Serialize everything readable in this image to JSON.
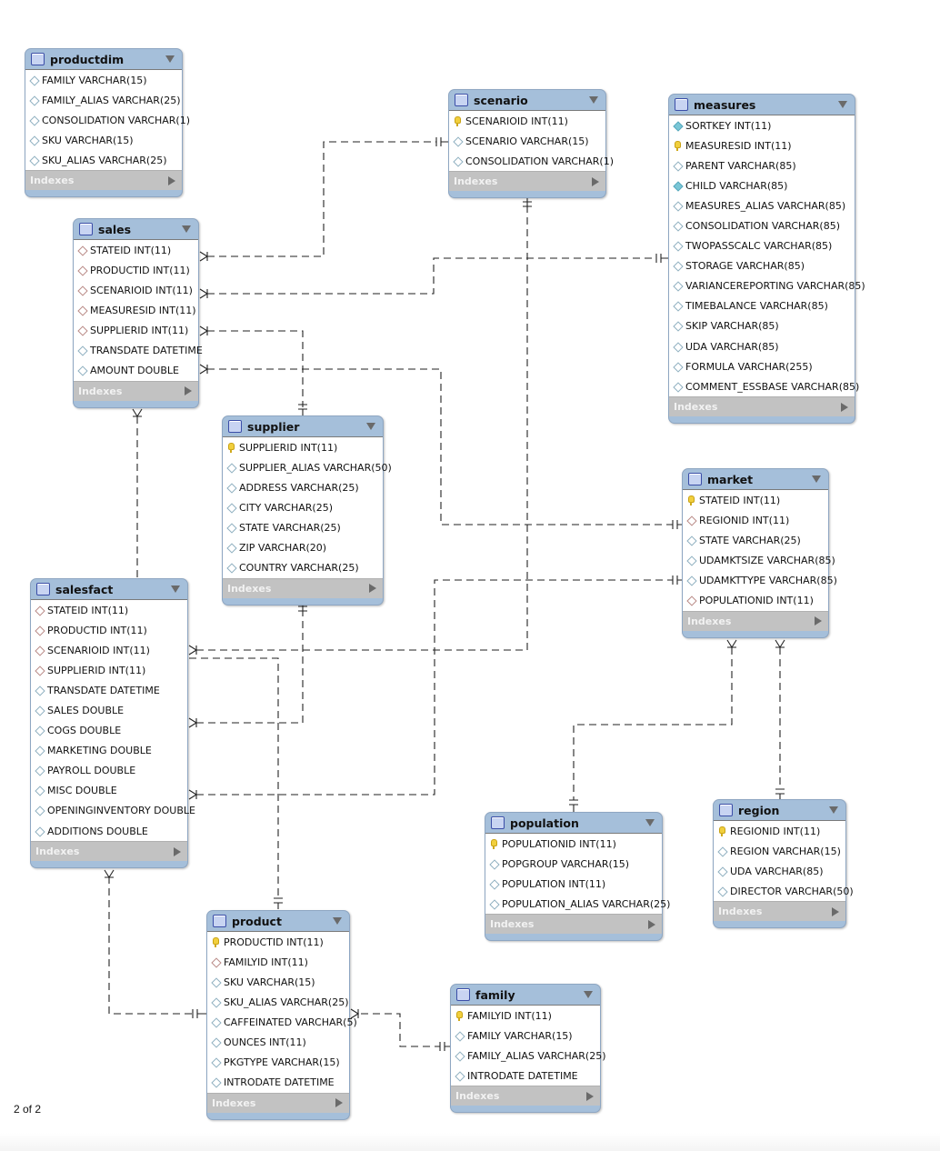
{
  "diagram": {
    "footer_label": "Indexes",
    "page_counter": "2 of 2",
    "tables": {
      "productdim": {
        "name": "productdim",
        "columns": [
          {
            "text": "FAMILY VARCHAR(15)",
            "icon": "column-diamond"
          },
          {
            "text": "FAMILY_ALIAS VARCHAR(25)",
            "icon": "column-diamond"
          },
          {
            "text": "CONSOLIDATION VARCHAR(1)",
            "icon": "column-diamond"
          },
          {
            "text": "SKU VARCHAR(15)",
            "icon": "column-diamond"
          },
          {
            "text": "SKU_ALIAS VARCHAR(25)",
            "icon": "column-diamond"
          }
        ]
      },
      "scenario": {
        "name": "scenario",
        "columns": [
          {
            "text": "SCENARIOID INT(11)",
            "icon": "primary-key"
          },
          {
            "text": "SCENARIO VARCHAR(15)",
            "icon": "column-diamond"
          },
          {
            "text": "CONSOLIDATION VARCHAR(1)",
            "icon": "column-diamond"
          }
        ]
      },
      "measures": {
        "name": "measures",
        "columns": [
          {
            "text": "SORTKEY INT(11)",
            "icon": "column-diamond-filled"
          },
          {
            "text": "MEASURESID INT(11)",
            "icon": "primary-key"
          },
          {
            "text": "PARENT VARCHAR(85)",
            "icon": "column-diamond"
          },
          {
            "text": "CHILD VARCHAR(85)",
            "icon": "column-diamond-filled"
          },
          {
            "text": "MEASURES_ALIAS VARCHAR(85)",
            "icon": "column-diamond"
          },
          {
            "text": "CONSOLIDATION VARCHAR(85)",
            "icon": "column-diamond"
          },
          {
            "text": "TWOPASSCALC VARCHAR(85)",
            "icon": "column-diamond"
          },
          {
            "text": "STORAGE VARCHAR(85)",
            "icon": "column-diamond"
          },
          {
            "text": "VARIANCEREPORTING VARCHAR(85)",
            "icon": "column-diamond"
          },
          {
            "text": "TIMEBALANCE VARCHAR(85)",
            "icon": "column-diamond"
          },
          {
            "text": "SKIP VARCHAR(85)",
            "icon": "column-diamond"
          },
          {
            "text": "UDA VARCHAR(85)",
            "icon": "column-diamond"
          },
          {
            "text": "FORMULA VARCHAR(255)",
            "icon": "column-diamond"
          },
          {
            "text": "COMMENT_ESSBASE VARCHAR(85)",
            "icon": "column-diamond"
          }
        ]
      },
      "sales": {
        "name": "sales",
        "columns": [
          {
            "text": "STATEID INT(11)",
            "icon": "foreign-key-diamond"
          },
          {
            "text": "PRODUCTID INT(11)",
            "icon": "foreign-key-diamond"
          },
          {
            "text": "SCENARIOID INT(11)",
            "icon": "foreign-key-diamond"
          },
          {
            "text": "MEASURESID INT(11)",
            "icon": "foreign-key-diamond"
          },
          {
            "text": "SUPPLIERID INT(11)",
            "icon": "foreign-key-diamond"
          },
          {
            "text": "TRANSDATE DATETIME",
            "icon": "column-diamond"
          },
          {
            "text": "AMOUNT DOUBLE",
            "icon": "column-diamond"
          }
        ]
      },
      "supplier": {
        "name": "supplier",
        "columns": [
          {
            "text": "SUPPLIERID INT(11)",
            "icon": "primary-key"
          },
          {
            "text": "SUPPLIER_ALIAS VARCHAR(50)",
            "icon": "column-diamond"
          },
          {
            "text": "ADDRESS VARCHAR(25)",
            "icon": "column-diamond"
          },
          {
            "text": "CITY VARCHAR(25)",
            "icon": "column-diamond"
          },
          {
            "text": "STATE VARCHAR(25)",
            "icon": "column-diamond"
          },
          {
            "text": "ZIP VARCHAR(20)",
            "icon": "column-diamond"
          },
          {
            "text": "COUNTRY VARCHAR(25)",
            "icon": "column-diamond"
          }
        ]
      },
      "market": {
        "name": "market",
        "columns": [
          {
            "text": "STATEID INT(11)",
            "icon": "primary-key"
          },
          {
            "text": "REGIONID INT(11)",
            "icon": "foreign-key-diamond"
          },
          {
            "text": "STATE VARCHAR(25)",
            "icon": "column-diamond"
          },
          {
            "text": "UDAMKTSIZE VARCHAR(85)",
            "icon": "column-diamond"
          },
          {
            "text": "UDAMKTTYPE VARCHAR(85)",
            "icon": "column-diamond"
          },
          {
            "text": "POPULATIONID INT(11)",
            "icon": "foreign-key-diamond"
          }
        ]
      },
      "salesfact": {
        "name": "salesfact",
        "columns": [
          {
            "text": "STATEID INT(11)",
            "icon": "foreign-key-diamond"
          },
          {
            "text": "PRODUCTID INT(11)",
            "icon": "foreign-key-diamond"
          },
          {
            "text": "SCENARIOID INT(11)",
            "icon": "foreign-key-diamond"
          },
          {
            "text": "SUPPLIERID INT(11)",
            "icon": "foreign-key-diamond"
          },
          {
            "text": "TRANSDATE DATETIME",
            "icon": "column-diamond"
          },
          {
            "text": "SALES DOUBLE",
            "icon": "column-diamond"
          },
          {
            "text": "COGS DOUBLE",
            "icon": "column-diamond"
          },
          {
            "text": "MARKETING DOUBLE",
            "icon": "column-diamond"
          },
          {
            "text": "PAYROLL DOUBLE",
            "icon": "column-diamond"
          },
          {
            "text": "MISC DOUBLE",
            "icon": "column-diamond"
          },
          {
            "text": "OPENINGINVENTORY DOUBLE",
            "icon": "column-diamond"
          },
          {
            "text": "ADDITIONS DOUBLE",
            "icon": "column-diamond"
          }
        ]
      },
      "population": {
        "name": "population",
        "columns": [
          {
            "text": "POPULATIONID INT(11)",
            "icon": "primary-key"
          },
          {
            "text": "POPGROUP VARCHAR(15)",
            "icon": "column-diamond"
          },
          {
            "text": "POPULATION INT(11)",
            "icon": "column-diamond"
          },
          {
            "text": "POPULATION_ALIAS VARCHAR(25)",
            "icon": "column-diamond"
          }
        ]
      },
      "region": {
        "name": "region",
        "columns": [
          {
            "text": "REGIONID INT(11)",
            "icon": "primary-key"
          },
          {
            "text": "REGION VARCHAR(15)",
            "icon": "column-diamond"
          },
          {
            "text": "UDA VARCHAR(85)",
            "icon": "column-diamond"
          },
          {
            "text": "DIRECTOR VARCHAR(50)",
            "icon": "column-diamond"
          }
        ]
      },
      "product": {
        "name": "product",
        "columns": [
          {
            "text": "PRODUCTID INT(11)",
            "icon": "primary-key"
          },
          {
            "text": "FAMILYID INT(11)",
            "icon": "foreign-key-diamond"
          },
          {
            "text": "SKU VARCHAR(15)",
            "icon": "column-diamond"
          },
          {
            "text": "SKU_ALIAS VARCHAR(25)",
            "icon": "column-diamond"
          },
          {
            "text": "CAFFEINATED VARCHAR(5)",
            "icon": "column-diamond"
          },
          {
            "text": "OUNCES INT(11)",
            "icon": "column-diamond"
          },
          {
            "text": "PKGTYPE VARCHAR(15)",
            "icon": "column-diamond"
          },
          {
            "text": "INTRODATE DATETIME",
            "icon": "column-diamond"
          }
        ]
      },
      "family": {
        "name": "family",
        "columns": [
          {
            "text": "FAMILYID INT(11)",
            "icon": "primary-key"
          },
          {
            "text": "FAMILY VARCHAR(15)",
            "icon": "column-diamond"
          },
          {
            "text": "FAMILY_ALIAS VARCHAR(25)",
            "icon": "column-diamond"
          },
          {
            "text": "INTRODATE DATETIME",
            "icon": "column-diamond"
          }
        ]
      }
    },
    "relationships": [
      {
        "from": "sales",
        "to": "scenario",
        "type": "many-to-one"
      },
      {
        "from": "sales",
        "to": "measures",
        "type": "many-to-one"
      },
      {
        "from": "sales",
        "to": "supplier",
        "type": "many-to-one"
      },
      {
        "from": "sales",
        "to": "market",
        "type": "many-to-one"
      },
      {
        "from": "sales",
        "to": "salesfact",
        "type": "many-to-one"
      },
      {
        "from": "salesfact",
        "to": "scenario",
        "type": "many-to-one"
      },
      {
        "from": "salesfact",
        "to": "supplier",
        "type": "many-to-one"
      },
      {
        "from": "salesfact",
        "to": "market",
        "type": "many-to-one"
      },
      {
        "from": "salesfact",
        "to": "product",
        "type": "many-to-one"
      },
      {
        "from": "market",
        "to": "population",
        "type": "many-to-one"
      },
      {
        "from": "market",
        "to": "region",
        "type": "many-to-one"
      },
      {
        "from": "product",
        "to": "family",
        "type": "many-to-one"
      }
    ]
  }
}
